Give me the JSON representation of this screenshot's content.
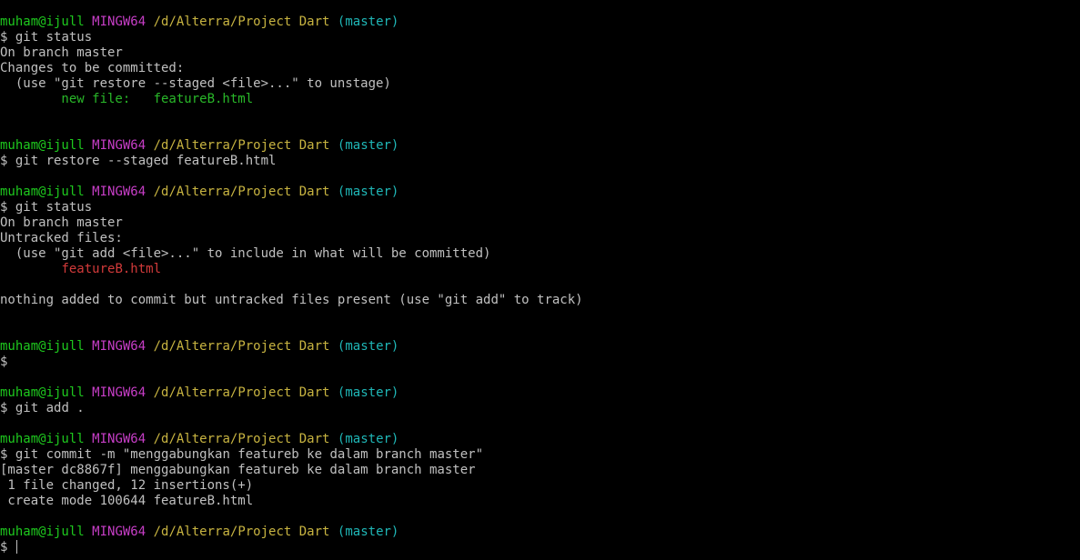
{
  "prompt": {
    "user": "muham@ijull",
    "host": "MINGW64",
    "path": "/d/Alterra/Project Dart",
    "branch": "(master)",
    "symbol": "$"
  },
  "output": {
    "status1": {
      "cmd": "git status",
      "branch_line": "On branch master",
      "header": "Changes to be committed:",
      "hint": "  (use \"git restore --staged <file>...\" to unstage)",
      "label": "        new file:   ",
      "file": "featureB.html"
    },
    "restore": {
      "cmd": "git restore --staged featureB.html"
    },
    "status2": {
      "cmd": "git status",
      "branch_line": "On branch master",
      "header": "Untracked files:",
      "hint": "  (use \"git add <file>...\" to include in what will be committed)",
      "indent": "        ",
      "file": "featureB.html",
      "summary": "nothing added to commit but untracked files present (use \"git add\" to track)"
    },
    "add": {
      "cmd": "git add ."
    },
    "commit": {
      "cmd": "git commit -m \"menggabungkan featureb ke dalam branch master\"",
      "result": "[master dc8867f] menggabungkan featureb ke dalam branch master",
      "changed": " 1 file changed, 12 insertions(+)",
      "mode": " create mode 100644 featureB.html"
    }
  },
  "colors": {
    "background": "#000000",
    "text": "#c0c0c0",
    "user": "#1ec91e",
    "host": "#c73ec7",
    "path": "#c8b441",
    "branch": "#1fb7b7",
    "staged_file": "#29b829",
    "untracked_file": "#d23a3a"
  }
}
